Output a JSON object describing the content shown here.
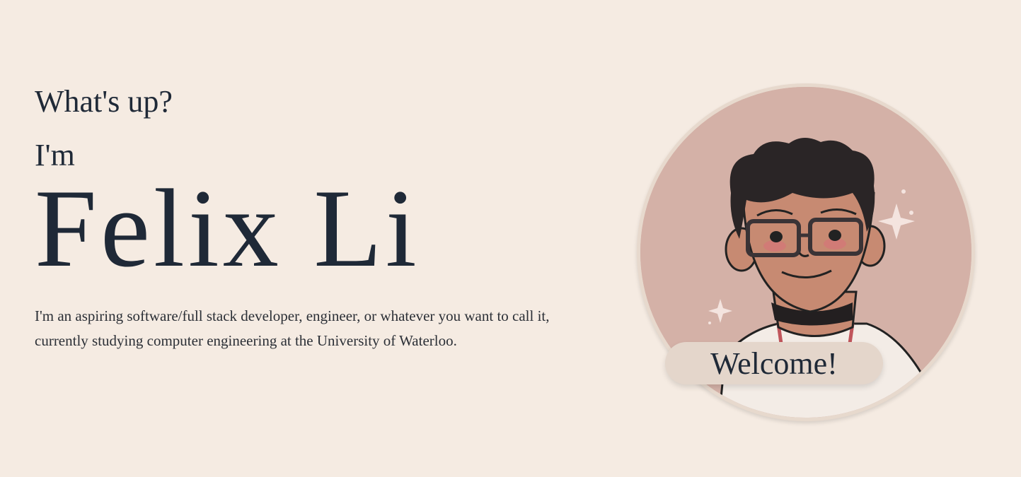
{
  "hero": {
    "greeting": "What's up?",
    "intro": "I'm",
    "name": "Felix Li",
    "bio": "I'm an aspiring software/full stack developer, engineer, or whatever you want to call it, currently studying computer engineering at the University of Waterloo."
  },
  "avatar": {
    "welcome_label": "Welcome!",
    "alt": "cartoon portrait",
    "colors": {
      "background": "#d4b1a7",
      "skin": "#c78a72",
      "hair": "#2a2526",
      "shirt": "#f3ece6",
      "sparkle": "#f4e4df"
    }
  },
  "theme": {
    "page_bg": "#f5ebe2",
    "text": "#1f2937"
  }
}
